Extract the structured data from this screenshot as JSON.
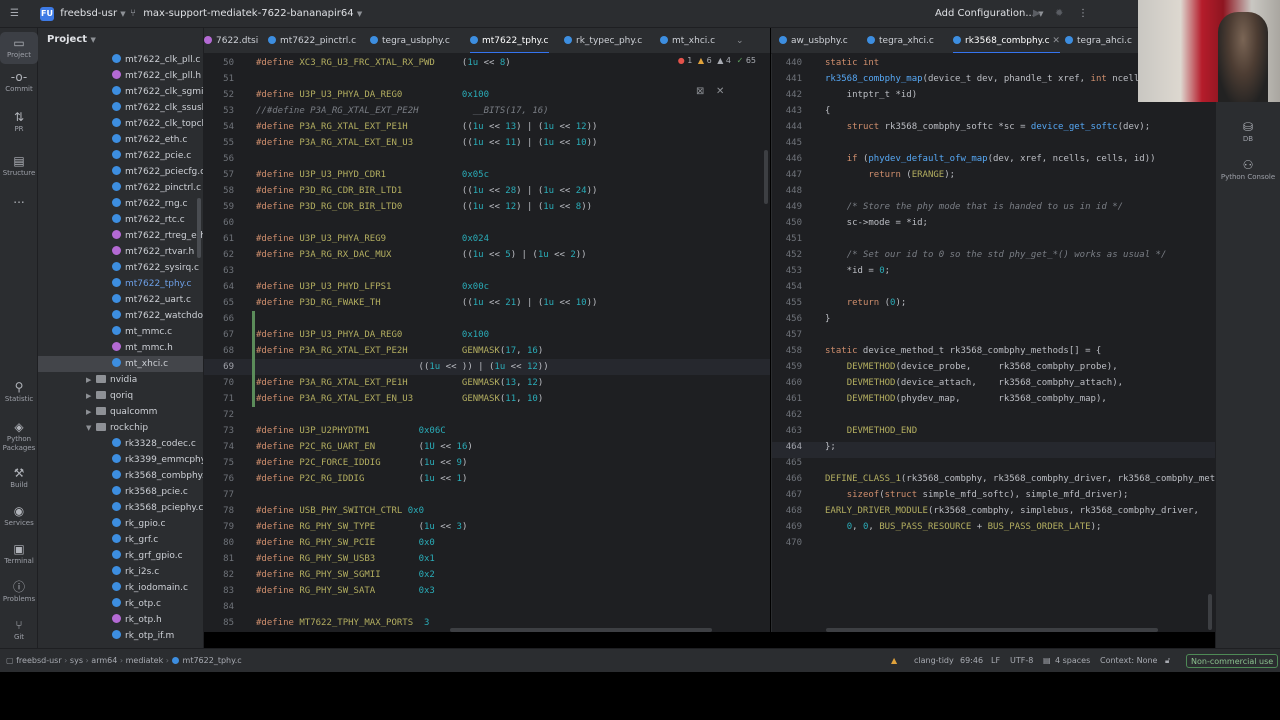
{
  "titlebar": {
    "project_badge": "FU",
    "project_name": "freebsd-usr",
    "branch": "max-support-mediatek-7622-bananapir64",
    "run_config": "Add Configuration..."
  },
  "left_strip": {
    "items": [
      "Project",
      "Commit",
      "PR",
      "Structure",
      "...",
      "Statistic",
      "Python Packages",
      "Build",
      "Services",
      "Terminal",
      "Problems",
      "Git"
    ]
  },
  "project_panel": {
    "title": "Project",
    "rows": [
      {
        "name": "mt7622_clk_pll.c",
        "kind": "c"
      },
      {
        "name": "mt7622_clk_pll.h",
        "kind": "h"
      },
      {
        "name": "mt7622_clk_sgmiis.c",
        "kind": "c"
      },
      {
        "name": "mt7622_clk_ssusbsys",
        "kind": "c"
      },
      {
        "name": "mt7622_clk_topckgen",
        "kind": "c"
      },
      {
        "name": "mt7622_eth.c",
        "kind": "c"
      },
      {
        "name": "mt7622_pcie.c",
        "kind": "c"
      },
      {
        "name": "mt7622_pciecfg.c",
        "kind": "c"
      },
      {
        "name": "mt7622_pinctrl.c",
        "kind": "c"
      },
      {
        "name": "mt7622_rng.c",
        "kind": "c"
      },
      {
        "name": "mt7622_rtc.c",
        "kind": "c"
      },
      {
        "name": "mt7622_rtreg_eth.h",
        "kind": "h"
      },
      {
        "name": "mt7622_rtvar.h",
        "kind": "h"
      },
      {
        "name": "mt7622_sysirq.c",
        "kind": "c"
      },
      {
        "name": "mt7622_tphy.c",
        "kind": "c",
        "blue": true
      },
      {
        "name": "mt7622_uart.c",
        "kind": "c"
      },
      {
        "name": "mt7622_watchdog.c",
        "kind": "c"
      },
      {
        "name": "mt_mmc.c",
        "kind": "c"
      },
      {
        "name": "mt_mmc.h",
        "kind": "h"
      },
      {
        "name": "mt_xhci.c",
        "kind": "c",
        "selected": true
      },
      {
        "name": "nvidia",
        "kind": "folder"
      },
      {
        "name": "qoriq",
        "kind": "folder"
      },
      {
        "name": "qualcomm",
        "kind": "folder"
      },
      {
        "name": "rockchip",
        "kind": "folder",
        "open": true
      },
      {
        "name": "rk3328_codec.c",
        "kind": "c"
      },
      {
        "name": "rk3399_emmcphy.c",
        "kind": "c"
      },
      {
        "name": "rk3568_combphy.c",
        "kind": "c"
      },
      {
        "name": "rk3568_pcie.c",
        "kind": "c"
      },
      {
        "name": "rk3568_pciephy.c",
        "kind": "c"
      },
      {
        "name": "rk_gpio.c",
        "kind": "c"
      },
      {
        "name": "rk_grf.c",
        "kind": "c"
      },
      {
        "name": "rk_grf_gpio.c",
        "kind": "c"
      },
      {
        "name": "rk_i2s.c",
        "kind": "c"
      },
      {
        "name": "rk_iodomain.c",
        "kind": "c"
      },
      {
        "name": "rk_otp.c",
        "kind": "c"
      },
      {
        "name": "rk_otp.h",
        "kind": "h"
      },
      {
        "name": "rk_otp_if.m",
        "kind": "c"
      }
    ]
  },
  "left_tabs": [
    "7622.dtsi",
    "mt7622_pinctrl.c",
    "tegra_usbphy.c",
    "mt7622_tphy.c",
    "rk_typec_phy.c",
    "mt_xhci.c"
  ],
  "right_tabs": [
    "aw_usbphy.c",
    "tegra_xhci.c",
    "rk3568_combphy.c",
    "tegra_ahci.c"
  ],
  "left_editor": {
    "inspections": {
      "errors": "1",
      "warnings": "6",
      "weak": "4",
      "typos": "65"
    },
    "lines": [
      {
        "n": "50",
        "t": "#define XC3_RG_U3_FRC_XTAL_RX_PWD     (1u << 8)"
      },
      {
        "n": "51",
        "t": ""
      },
      {
        "n": "52",
        "t": "#define U3P_U3_PHYA_DA_REG0           0x100"
      },
      {
        "n": "53",
        "t": "//#define P3A_RG_XTAL_EXT_PE2H          __BITS(17, 16)"
      },
      {
        "n": "54",
        "t": "#define P3A_RG_XTAL_EXT_PE1H          ((1u << 13) | (1u << 12))"
      },
      {
        "n": "55",
        "t": "#define P3A_RG_XTAL_EXT_EN_U3         ((1u << 11) | (1u << 10))"
      },
      {
        "n": "56",
        "t": ""
      },
      {
        "n": "57",
        "t": "#define U3P_U3_PHYD_CDR1              0x05c"
      },
      {
        "n": "58",
        "t": "#define P3D_RG_CDR_BIR_LTD1           ((1u << 28) | (1u << 24))"
      },
      {
        "n": "59",
        "t": "#define P3D_RG_CDR_BIR_LTD0           ((1u << 12) | (1u << 8))"
      },
      {
        "n": "60",
        "t": ""
      },
      {
        "n": "61",
        "t": "#define U3P_U3_PHYA_REG9              0x024"
      },
      {
        "n": "62",
        "t": "#define P3A_RG_RX_DAC_MUX             ((1u << 5) | (1u << 2))"
      },
      {
        "n": "63",
        "t": ""
      },
      {
        "n": "64",
        "t": "#define U3P_U3_PHYD_LFPS1             0x00c"
      },
      {
        "n": "65",
        "t": "#define P3D_RG_FWAKE_TH               ((1u << 21) | (1u << 10))"
      },
      {
        "n": "66",
        "t": ""
      },
      {
        "n": "67",
        "t": "#define U3P_U3_PHYA_DA_REG0           0x100"
      },
      {
        "n": "68",
        "t": "#define P3A_RG_XTAL_EXT_PE2H          GENMASK(17, 16)"
      },
      {
        "n": "69",
        "t": "                              ((1u << )) | (1u << 12))"
      },
      {
        "n": "70",
        "t": "#define P3A_RG_XTAL_EXT_PE1H          GENMASK(13, 12)"
      },
      {
        "n": "71",
        "t": "#define P3A_RG_XTAL_EXT_EN_U3         GENMASK(11, 10)"
      },
      {
        "n": "72",
        "t": ""
      },
      {
        "n": "73",
        "t": "#define U3P_U2PHYDTM1         0x06C"
      },
      {
        "n": "74",
        "t": "#define P2C_RG_UART_EN        (1U << 16)"
      },
      {
        "n": "75",
        "t": "#define P2C_FORCE_IDDIG       (1u << 9)"
      },
      {
        "n": "76",
        "t": "#define P2C_RG_IDDIG          (1u << 1)"
      },
      {
        "n": "77",
        "t": ""
      },
      {
        "n": "78",
        "t": "#define USB_PHY_SWITCH_CTRL 0x0"
      },
      {
        "n": "79",
        "t": "#define RG_PHY_SW_TYPE        (1u << 3)"
      },
      {
        "n": "80",
        "t": "#define RG_PHY_SW_PCIE        0x0"
      },
      {
        "n": "81",
        "t": "#define RG_PHY_SW_USB3        0x1"
      },
      {
        "n": "82",
        "t": "#define RG_PHY_SW_SGMII       0x2"
      },
      {
        "n": "83",
        "t": "#define RG_PHY_SW_SATA        0x3"
      },
      {
        "n": "84",
        "t": ""
      },
      {
        "n": "85",
        "t": "#define MT7622_TPHY_MAX_PORTS  3"
      }
    ],
    "current_line": "69"
  },
  "right_editor": {
    "inspections": {
      "warnings": "6",
      "weak": "2"
    },
    "lines": [
      {
        "n": "440",
        "t": "static int"
      },
      {
        "n": "441",
        "t": "rk3568_combphy_map(device_t dev, phandle_t xref, int ncells,"
      },
      {
        "n": "442",
        "t": "    intptr_t *id)"
      },
      {
        "n": "443",
        "t": "{"
      },
      {
        "n": "444",
        "t": "    struct rk3568_combphy_softc *sc = device_get_softc(dev);"
      },
      {
        "n": "445",
        "t": ""
      },
      {
        "n": "446",
        "t": "    if (phydev_default_ofw_map(dev, xref, ncells, cells, id))"
      },
      {
        "n": "447",
        "t": "        return (ERANGE);"
      },
      {
        "n": "448",
        "t": ""
      },
      {
        "n": "449",
        "t": "    /* Store the phy mode that is handed to us in id */"
      },
      {
        "n": "450",
        "t": "    sc->mode = *id;"
      },
      {
        "n": "451",
        "t": ""
      },
      {
        "n": "452",
        "t": "    /* Set our id to 0 so the std phy_get_*() works as usual */"
      },
      {
        "n": "453",
        "t": "    *id = 0;"
      },
      {
        "n": "454",
        "t": ""
      },
      {
        "n": "455",
        "t": "    return (0);"
      },
      {
        "n": "456",
        "t": "}"
      },
      {
        "n": "457",
        "t": ""
      },
      {
        "n": "458",
        "t": "static device_method_t rk3568_combphy_methods[] = {"
      },
      {
        "n": "459",
        "t": "    DEVMETHOD(device_probe,     rk3568_combphy_probe),"
      },
      {
        "n": "460",
        "t": "    DEVMETHOD(device_attach,    rk3568_combphy_attach),"
      },
      {
        "n": "461",
        "t": "    DEVMETHOD(phydev_map,       rk3568_combphy_map),"
      },
      {
        "n": "462",
        "t": ""
      },
      {
        "n": "463",
        "t": "    DEVMETHOD_END"
      },
      {
        "n": "464",
        "t": "};"
      },
      {
        "n": "465",
        "t": ""
      },
      {
        "n": "466",
        "t": "DEFINE_CLASS_1(rk3568_combphy, rk3568_combphy_driver, rk3568_combphy_meth"
      },
      {
        "n": "467",
        "t": "    sizeof(struct simple_mfd_softc), simple_mfd_driver);"
      },
      {
        "n": "468",
        "t": "EARLY_DRIVER_MODULE(rk3568_combphy, simplebus, rk3568_combphy_driver,"
      },
      {
        "n": "469",
        "t": "    0, 0, BUS_PASS_RESOURCE + BUS_PASS_ORDER_LATE);"
      },
      {
        "n": "470",
        "t": ""
      }
    ],
    "current_line": "464"
  },
  "right_strip": {
    "items": [
      "DB",
      "Python Console"
    ]
  },
  "statusbar": {
    "breadcrumb": [
      "freebsd-usr",
      "sys",
      "arm64",
      "mediatek",
      "mt7622_tphy.c"
    ],
    "linter": "clang-tidy",
    "position": "69:46",
    "line_ending": "LF",
    "encoding": "UTF-8",
    "indent": "4 spaces",
    "context": "Context: None",
    "license": "Non-commercial use"
  },
  "colors": {
    "accent": "#3574f0",
    "bg": "#1e1f22",
    "panel": "#2b2d30"
  }
}
